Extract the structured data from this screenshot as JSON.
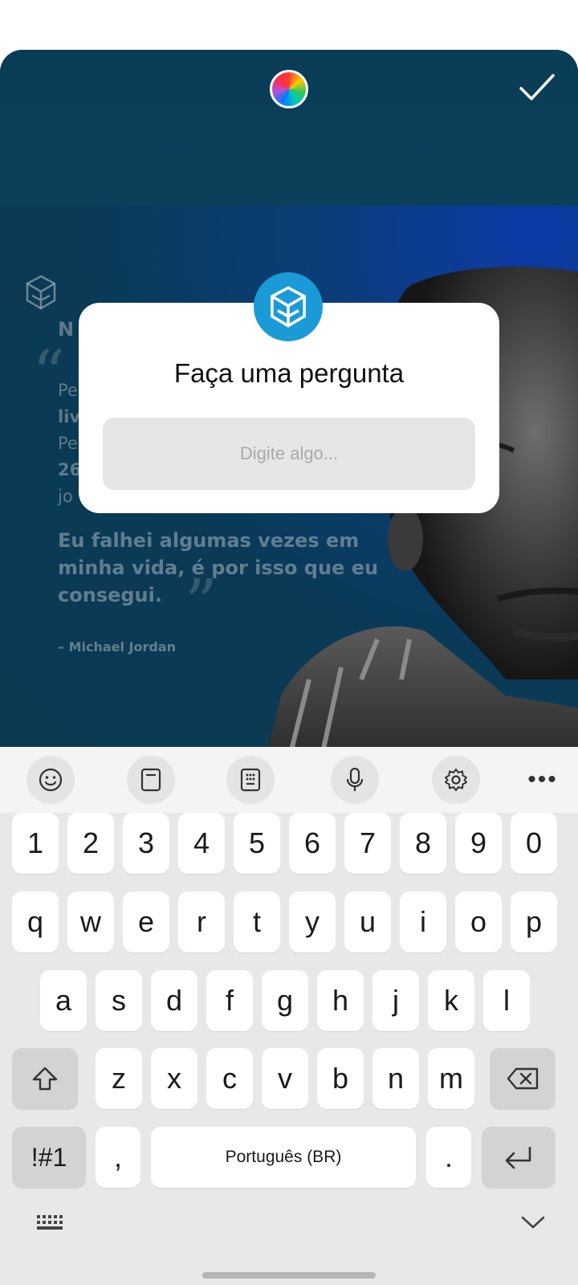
{
  "editor": {
    "color_picker_icon": "color-wheel-icon",
    "done_icon": "check-icon"
  },
  "background_post": {
    "heading_fragment": "N",
    "line_fragments": [
      "Pe",
      "liv",
      "Pe",
      "26",
      "jo"
    ],
    "quote": "Eu falhei algumas vezes em minha vida, é por isso que eu consegui.",
    "author": "– Michael Jordan"
  },
  "sticker": {
    "title": "Faça uma pergunta",
    "input_placeholder": "Digite algo...",
    "input_value": ""
  },
  "keyboard_toolbar": {
    "items": [
      "emoji-icon",
      "clipboard-icon",
      "keypad-icon",
      "microphone-icon",
      "settings-icon",
      "more-icon"
    ],
    "more_label": "•••"
  },
  "keyboard": {
    "number_row": [
      "1",
      "2",
      "3",
      "4",
      "5",
      "6",
      "7",
      "8",
      "9",
      "0"
    ],
    "row1": [
      "q",
      "w",
      "e",
      "r",
      "t",
      "y",
      "u",
      "i",
      "o",
      "p"
    ],
    "row2": [
      "a",
      "s",
      "d",
      "f",
      "g",
      "h",
      "j",
      "k",
      "l"
    ],
    "row3": [
      "z",
      "x",
      "c",
      "v",
      "b",
      "n",
      "m"
    ],
    "symbols_label": "!#1",
    "comma_label": ",",
    "space_label": "Português (BR)",
    "period_label": "."
  }
}
